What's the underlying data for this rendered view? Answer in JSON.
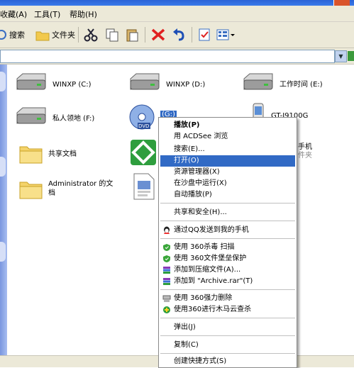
{
  "menubar": {
    "favorites": "收藏(A)",
    "tools": "工具(T)",
    "help": "帮助(H)"
  },
  "toolbar": {
    "search": "搜索",
    "folders": "文件夹"
  },
  "drives": [
    {
      "label": "WINXP (C:)",
      "icon": "hard-drive-icon"
    },
    {
      "label": "WINXP (D:)",
      "icon": "hard-drive-icon"
    },
    {
      "label": "工作时间 (E:)",
      "icon": "hard-drive-icon"
    },
    {
      "label": "私人领地 (F:)",
      "icon": "hard-drive-icon"
    },
    {
      "label": "(G:)",
      "icon": "dvd-drive-icon"
    },
    {
      "label": "GT-I9100G",
      "icon": "phone-icon"
    }
  ],
  "folders": [
    {
      "label": "共享文档"
    },
    {
      "label": "Administrator 的文档"
    }
  ],
  "partial_item": {
    "label_line1": "手机",
    "label_line2": "件夹"
  },
  "context_menu": [
    {
      "label": "播放(P)",
      "bold": true
    },
    {
      "label": "用 ACDSee 浏览"
    },
    {
      "label": "搜索(E)..."
    },
    {
      "label": "打开(O)",
      "highlight": true
    },
    {
      "label": "资源管理器(X)"
    },
    {
      "label": "在沙盘中运行(X)"
    },
    {
      "label": "自动播放(P)"
    },
    {
      "label": "共享和安全(H)..."
    },
    {
      "label": "通过QQ发送到我的手机",
      "icon": "qq-icon"
    },
    {
      "label": "使用 360杀毒 扫描",
      "icon": "shield-icon"
    },
    {
      "label": "使用 360文件堡垒保护",
      "icon": "shield-icon"
    },
    {
      "label": "添加到压缩文件(A)...",
      "icon": "archive-icon"
    },
    {
      "label": "添加到 \"Archive.rar\"(T)",
      "icon": "archive-icon"
    },
    {
      "label": "使用 360强力删除",
      "icon": "shredder-icon"
    },
    {
      "label": "使用360进行木马云查杀",
      "icon": "plus-shield-icon"
    },
    {
      "label": "弹出(J)"
    },
    {
      "label": "复制(C)"
    },
    {
      "label": "创建快捷方式(S)"
    }
  ],
  "colors": {
    "highlight": "#316ac5",
    "chrome": "#ece9d8",
    "sidebar": "#7a96df"
  }
}
